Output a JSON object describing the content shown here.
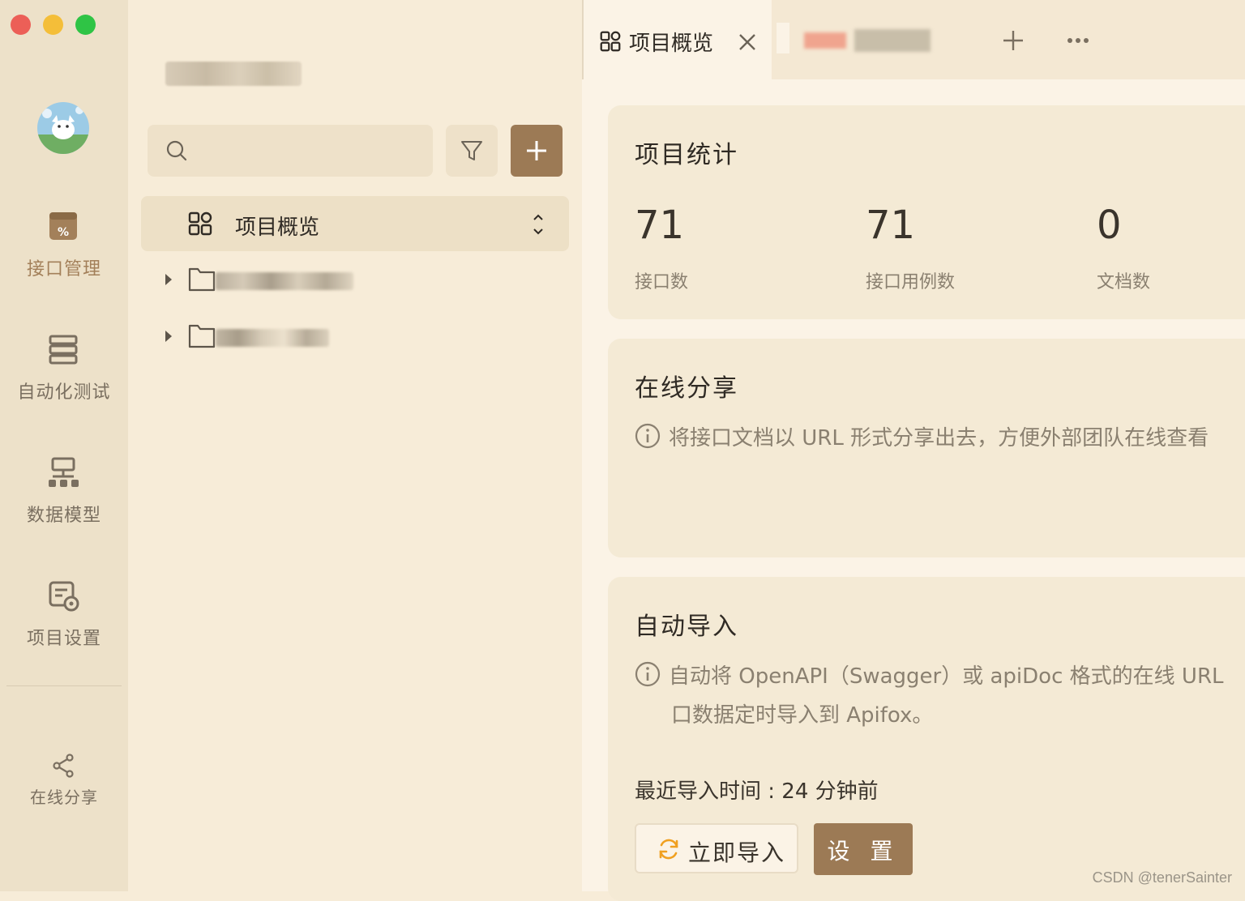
{
  "rail": {
    "items": [
      {
        "label": "接口管理",
        "icon": "api-management-icon",
        "active": true
      },
      {
        "label": "自动化测试",
        "icon": "automation-test-icon",
        "active": false
      },
      {
        "label": "数据模型",
        "icon": "data-model-icon",
        "active": false
      },
      {
        "label": "项目设置",
        "icon": "project-settings-icon",
        "active": false
      }
    ],
    "share": {
      "label": "在线分享",
      "icon": "share-icon"
    }
  },
  "sidebar": {
    "search": {
      "placeholder": ""
    },
    "tree": {
      "selected": {
        "label": "项目概览"
      }
    }
  },
  "tabs": {
    "active": {
      "label": "项目概览"
    }
  },
  "stats": {
    "title": "项目统计",
    "items": [
      {
        "value": "71",
        "label": "接口数"
      },
      {
        "value": "71",
        "label": "接口用例数"
      },
      {
        "value": "0",
        "label": "文档数"
      }
    ]
  },
  "share_card": {
    "title": "在线分享",
    "desc": "将接口文档以 URL 形式分享出去，方便外部团队在线查看"
  },
  "import_card": {
    "title": "自动导入",
    "desc_line1": "自动将 OpenAPI（Swagger）或 apiDoc 格式的在线 URL",
    "desc_line2": "口数据定时导入到 Apifox。",
    "last_import": "最近导入时间 : 24 分钟前",
    "import_now_label": "立即导入",
    "settings_label": "设 置"
  },
  "watermark": "CSDN @tenerSainter",
  "colors": {
    "accent": "#9c7a55",
    "rail_bg": "#ede1c9",
    "card_bg": "#f4ead5",
    "active_label": "#a3805a"
  }
}
